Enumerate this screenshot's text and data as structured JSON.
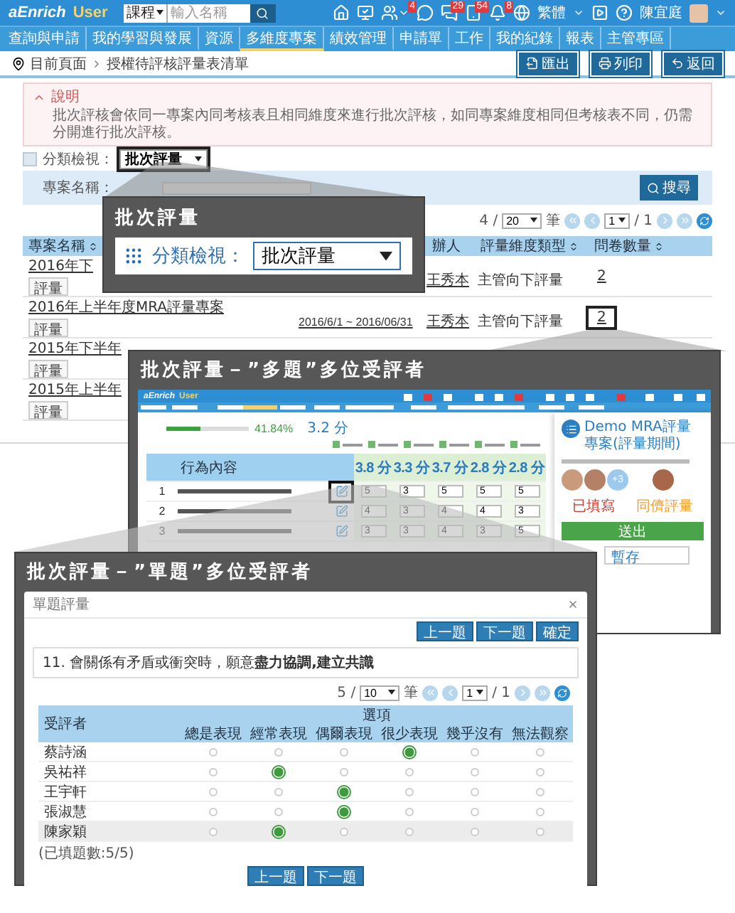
{
  "top_bar": {
    "logo": "aEnrich",
    "product": "User",
    "search_scope": "課程",
    "search_placeholder": "輸入名稱",
    "icons": [
      {
        "kind": "home"
      },
      {
        "kind": "monitor"
      },
      {
        "kind": "people",
        "badge": "4",
        "menu": true
      },
      {
        "kind": "chat"
      },
      {
        "kind": "chats",
        "badge": "29"
      },
      {
        "kind": "tablet",
        "badge": "54"
      },
      {
        "kind": "bell",
        "badge": "8"
      }
    ],
    "language": "繁體",
    "tools": [
      {
        "kind": "play"
      },
      {
        "kind": "help"
      }
    ],
    "user": "陳宜庭"
  },
  "nav": [
    {
      "label": "查詢與申請",
      "selected": false
    },
    {
      "label": "我的學習與發展",
      "selected": false
    },
    {
      "label": "資源",
      "selected": false
    },
    {
      "label": "多維度專案",
      "selected": true
    },
    {
      "label": "績效管理",
      "selected": false
    },
    {
      "label": "申請單",
      "selected": false
    },
    {
      "label": "工作",
      "selected": false
    },
    {
      "label": "我的紀錄",
      "selected": false
    },
    {
      "label": "報表",
      "selected": false
    },
    {
      "label": "主管專區",
      "selected": false
    }
  ],
  "breadcrumb": [
    "目前頁面",
    "授權待評核評量表清單"
  ],
  "actions": [
    {
      "kind": "export",
      "label": "匯出"
    },
    {
      "kind": "print",
      "label": "列印"
    },
    {
      "kind": "back",
      "label": "返回"
    }
  ],
  "notice": {
    "title": "說明",
    "expanded": true,
    "text": "批次評核會依同一專案內同考核表且相同維度來進行批次評核，如同專案維度相同但考核表不同，仍需分開進行批次評核。"
  },
  "filter": {
    "checked": false,
    "label": "分類檢視：",
    "value": "批次評量",
    "highlighted": true
  },
  "search": {
    "label": "專案名稱：",
    "button": "搜尋"
  },
  "pager": {
    "count": "4 /",
    "page_size": "20",
    "unit": "筆",
    "page": "1",
    "total": "/ 1"
  },
  "table": {
    "columns": [
      {
        "label": "專案名稱",
        "sortable": true
      },
      {
        "label": "辦人",
        "sortable": false
      },
      {
        "label": "評量維度類型",
        "sortable": true
      },
      {
        "label": "問卷數量",
        "sortable": true
      }
    ],
    "rows": [
      {
        "name": "2016年下",
        "action": "評量",
        "person": "王秀本",
        "type": "主管向下評量",
        "count": "2",
        "highlighted": false
      },
      {
        "name": "2016年上半年度MRA評量專案",
        "action": "評量",
        "period": "2016/6/1 ~ 2016/06/31",
        "person": "王秀本",
        "type": "主管向下評量",
        "count": "2",
        "highlighted": true
      },
      {
        "name": "2015年下半年",
        "action": "評量"
      },
      {
        "name": "2015年上半年",
        "action": "評量"
      }
    ]
  },
  "callout_filter": {
    "title": "批次評量",
    "label": "分類檢視：",
    "value": "批次評量"
  },
  "callout_multi": {
    "title": "批次評量－”多題”多位受評者",
    "mini": {
      "logo": "aEnrich",
      "product": "User",
      "progress": {
        "level": 0.42,
        "reading": "41.84%"
      },
      "average": "3.2 分",
      "column": "行為內容",
      "scores": [
        "3.8 分",
        "3.3 分",
        "3.7 分",
        "2.8 分",
        "2.8 分"
      ],
      "rows": [
        {
          "number": "1",
          "values": [
            "5",
            "3",
            "5",
            "5",
            "5"
          ],
          "highlighted": true
        },
        {
          "number": "2",
          "values": [
            "4",
            "3",
            "4",
            "4",
            "3"
          ],
          "highlighted": false
        },
        {
          "number": "3",
          "values": [
            "3",
            "3",
            "4",
            "3",
            "5"
          ],
          "highlighted": false
        }
      ],
      "panel": {
        "title": "Demo MRA評量專案(評量期間)",
        "extra": "+3",
        "status": "已填寫",
        "type": "同儕評量",
        "submit": "送出",
        "save": "暫存"
      }
    }
  },
  "callout_single": {
    "title": "批次評量－”單題”多位受評者",
    "modal": {
      "title": "單題評量",
      "buttons": [
        "上一題",
        "下一題",
        "確定"
      ],
      "question": "11. 會關係有矛盾或衝突時，願意**盡力協調,建立共識**",
      "pager": {
        "count": "5 /",
        "page_size": "10",
        "unit": "筆",
        "page": "1",
        "total": "/ 1"
      },
      "rater_column": "受評者",
      "group": "選項",
      "options": [
        "總是表現",
        "經常表現",
        "偶爾表現",
        "很少表現",
        "幾乎沒有",
        "無法觀察"
      ],
      "rows": [
        {
          "name": "蔡詩涵",
          "highlighted": false,
          "choices": [
            {
              "selected": false
            },
            {
              "selected": false
            },
            {
              "selected": false
            },
            {
              "selected": true
            },
            {
              "selected": false
            },
            {
              "selected": false
            }
          ]
        },
        {
          "name": "吳祐祥",
          "highlighted": false,
          "choices": [
            {
              "selected": false
            },
            {
              "selected": true
            },
            {
              "selected": false
            },
            {
              "selected": false
            },
            {
              "selected": false
            },
            {
              "selected": false
            }
          ]
        },
        {
          "name": "王宇軒",
          "highlighted": false,
          "choices": [
            {
              "selected": false
            },
            {
              "selected": false
            },
            {
              "selected": true
            },
            {
              "selected": false
            },
            {
              "selected": false
            },
            {
              "selected": false
            }
          ]
        },
        {
          "name": "張淑慧",
          "highlighted": false,
          "choices": [
            {
              "selected": false
            },
            {
              "selected": false
            },
            {
              "selected": true
            },
            {
              "selected": false
            },
            {
              "selected": false
            },
            {
              "selected": false
            }
          ]
        },
        {
          "name": "陳家穎",
          "highlighted": true,
          "choices": [
            {
              "selected": false
            },
            {
              "selected": true
            },
            {
              "selected": false
            },
            {
              "selected": false
            },
            {
              "selected": false
            },
            {
              "selected": false
            }
          ]
        }
      ],
      "progress": "(已填題數:5/5)",
      "nav": [
        "上一題",
        "下一題"
      ]
    }
  }
}
